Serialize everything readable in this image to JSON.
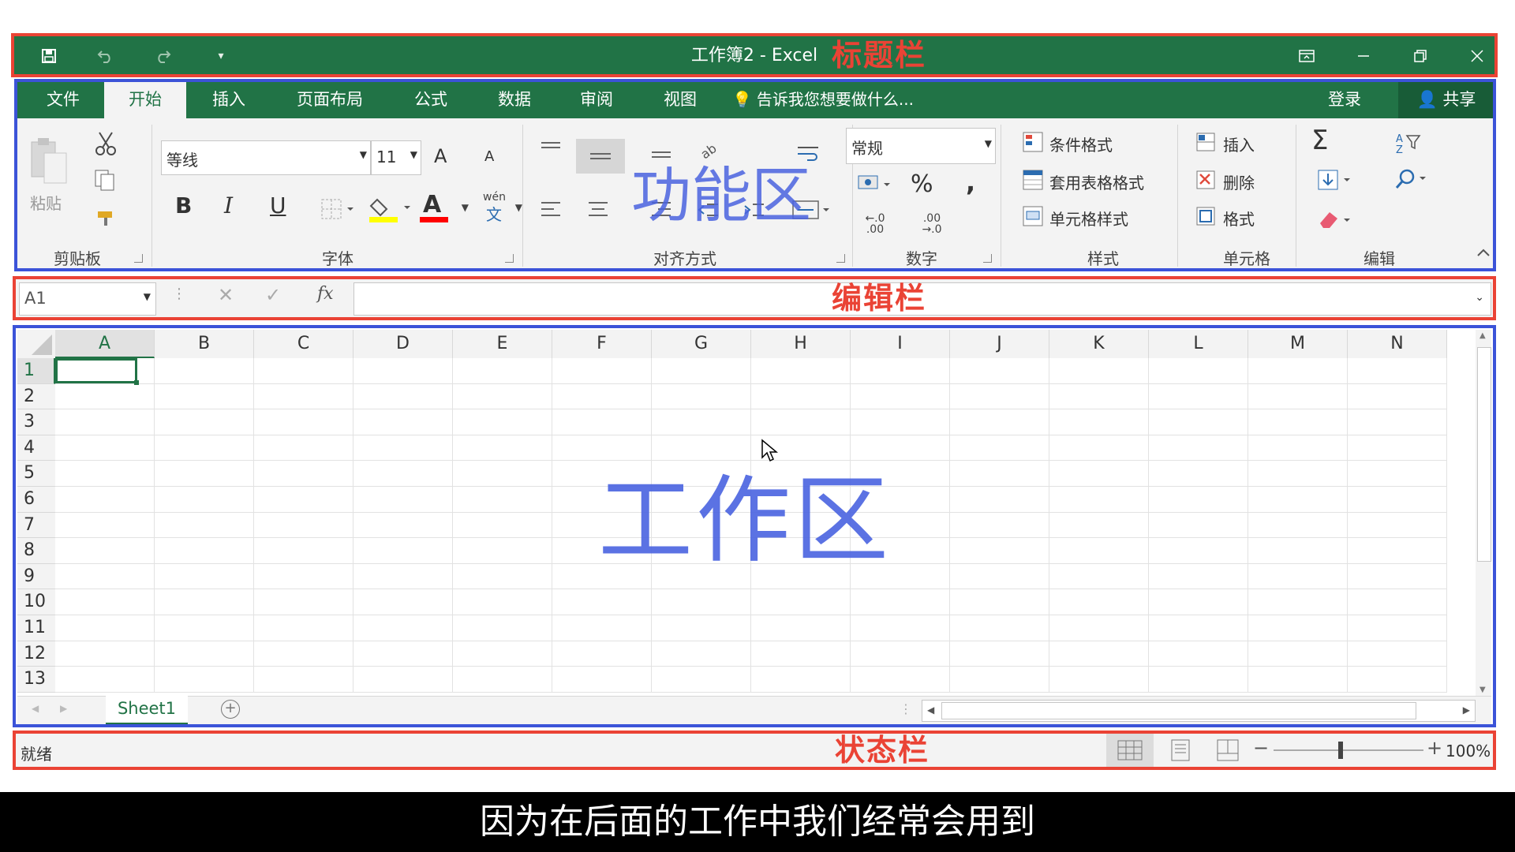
{
  "titlebar": {
    "title": "工作簿2 - Excel",
    "annotation": "标题栏",
    "quick_access": [
      "save-icon",
      "undo-icon",
      "redo-icon",
      "customize-icon"
    ],
    "window_controls": [
      "ribbon-display-icon",
      "minimize-icon",
      "restore-icon",
      "close-icon"
    ]
  },
  "tabs": {
    "items": [
      "文件",
      "开始",
      "插入",
      "页面布局",
      "公式",
      "数据",
      "审阅",
      "视图"
    ],
    "active": "开始",
    "tell_me": "告诉我您想要做什么...",
    "login": "登录",
    "share": "共享"
  },
  "ribbon": {
    "annotation": "功能区",
    "clipboard": {
      "paste": "粘贴",
      "label": "剪贴板"
    },
    "font": {
      "family": "等线",
      "size": "11",
      "bold": "B",
      "italic": "I",
      "underline": "U",
      "font_color_glyph": "A",
      "phonetic": "wén",
      "phonetic2": "文",
      "grow": "A",
      "shrink": "A",
      "label": "字体",
      "fill_color": "#ffff00",
      "text_color": "#ff0000"
    },
    "alignment": {
      "label": "对齐方式"
    },
    "number": {
      "format": "常规",
      "percent": "%",
      "comma": ",",
      "inc_decimal_a": "←.0",
      "inc_decimal_b": ".00",
      "dec_decimal_a": ".00",
      "dec_decimal_b": "→.0",
      "label": "数字"
    },
    "styles": {
      "conditional": "条件格式",
      "table": "套用表格格式",
      "cell": "单元格样式",
      "label": "样式"
    },
    "cells": {
      "insert": "插入",
      "delete": "删除",
      "format": "格式",
      "label": "单元格"
    },
    "editing": {
      "sum": "Σ",
      "label": "编辑"
    }
  },
  "formula_bar": {
    "name_box": "A1",
    "fx": "fx",
    "annotation": "编辑栏",
    "value": ""
  },
  "grid": {
    "annotation": "工作区",
    "columns": [
      "A",
      "B",
      "C",
      "D",
      "E",
      "F",
      "G",
      "H",
      "I",
      "J",
      "K",
      "L",
      "M",
      "N"
    ],
    "rows": [
      "1",
      "2",
      "3",
      "4",
      "5",
      "6",
      "7",
      "8",
      "9",
      "10",
      "11",
      "12",
      "13"
    ],
    "active_cell": "A1",
    "sheet_tab": "Sheet1"
  },
  "status": {
    "ready": "就绪",
    "annotation": "状态栏",
    "zoom": "100%"
  },
  "subtitle": "因为在后面的工作中我们经常会用到",
  "colors": {
    "excel_green": "#217346",
    "annotation_red": "#ea4335",
    "annotation_blue": "#3b53d8"
  }
}
